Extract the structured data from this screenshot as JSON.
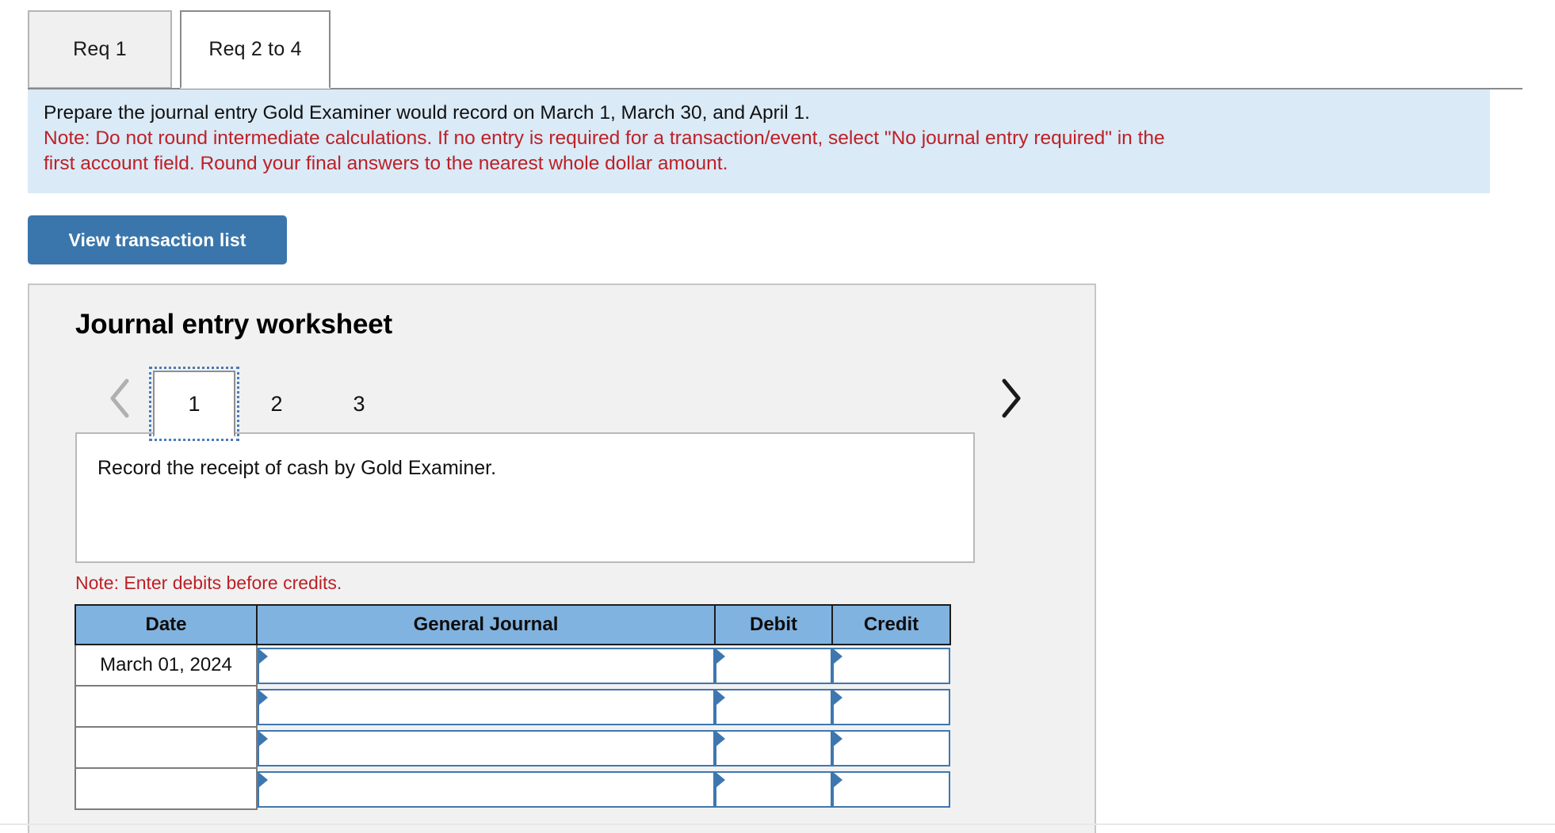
{
  "tabs": [
    {
      "label": "Req 1",
      "active": false
    },
    {
      "label": "Req 2 to 4",
      "active": true
    }
  ],
  "instructions": {
    "prompt": "Prepare the journal entry Gold Examiner would record on March 1, March 30, and April 1.",
    "note_line1": "Note: Do not round intermediate calculations. If no entry is required for a transaction/event, select \"No journal entry required\" in the",
    "note_line2": "first account field. Round your final answers to the nearest whole dollar amount.",
    "note_color": "#bd2026",
    "background_color": "#daeaf7"
  },
  "view_transaction_button": {
    "label": "View transaction list",
    "color": "#3a76ac"
  },
  "worksheet": {
    "title": "Journal entry worksheet",
    "pager": {
      "prev_icon": "chevron-left-icon",
      "next_icon": "chevron-right-icon",
      "prev_enabled": false,
      "next_enabled": true,
      "pages": [
        "1",
        "2",
        "3"
      ],
      "active_page": "1"
    },
    "description": "Record the receipt of cash by Gold Examiner.",
    "debit_note": "Note: Enter debits before credits.",
    "table": {
      "headers": [
        "Date",
        "General Journal",
        "Debit",
        "Credit"
      ],
      "header_color": "#81b3e0",
      "rows": [
        {
          "date": "March 01, 2024",
          "general_journal": "",
          "debit": "",
          "credit": ""
        },
        {
          "date": "",
          "general_journal": "",
          "debit": "",
          "credit": ""
        },
        {
          "date": "",
          "general_journal": "",
          "debit": "",
          "credit": ""
        },
        {
          "date": "",
          "general_journal": "",
          "debit": "",
          "credit": ""
        }
      ]
    }
  }
}
